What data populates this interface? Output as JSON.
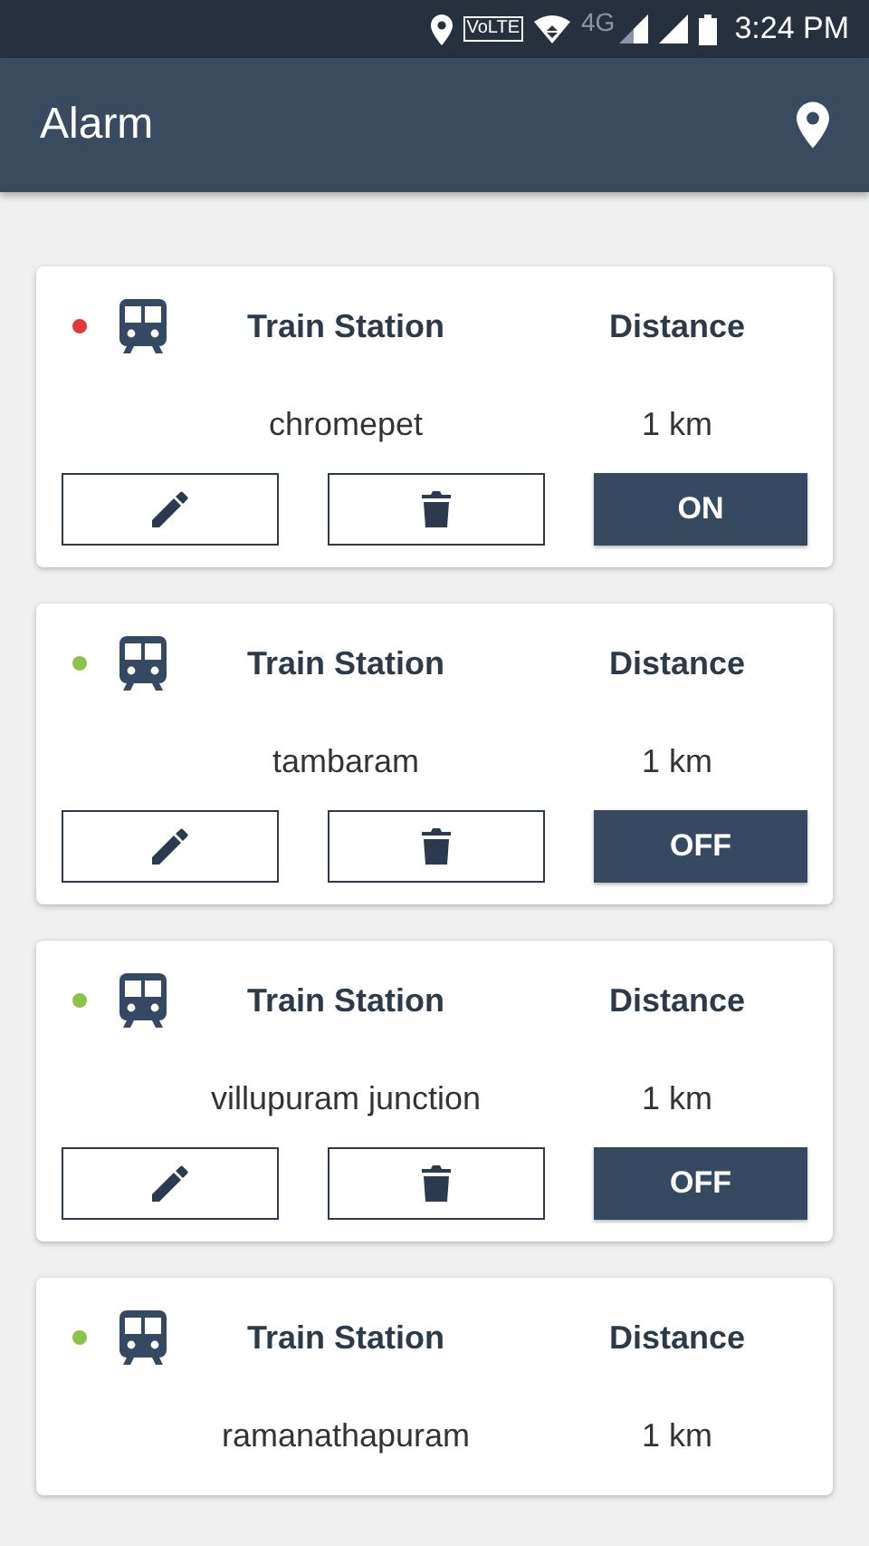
{
  "status_bar": {
    "volte": "VoLTE",
    "network": "4G",
    "time": "3:24 PM"
  },
  "app_bar": {
    "title": "Alarm"
  },
  "alarms": [
    {
      "color": "#e53935",
      "station_label": "Train Station",
      "distance_label": "Distance",
      "station": "chromepet",
      "distance": "1 km",
      "toggle": "ON"
    },
    {
      "color": "#8bc34a",
      "station_label": "Train Station",
      "distance_label": "Distance",
      "station": "tambaram",
      "distance": "1 km",
      "toggle": "OFF"
    },
    {
      "color": "#8bc34a",
      "station_label": "Train Station",
      "distance_label": "Distance",
      "station": "villupuram junction",
      "distance": "1 km",
      "toggle": "OFF"
    },
    {
      "color": "#8bc34a",
      "station_label": "Train Station",
      "distance_label": "Distance",
      "station": "ramanathapuram",
      "distance": "1 km"
    }
  ]
}
